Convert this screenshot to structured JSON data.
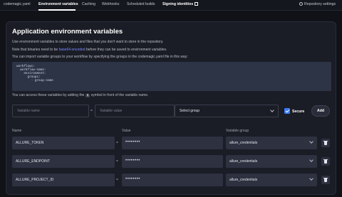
{
  "tabs": [
    {
      "label": "codemagic.yaml",
      "active": false
    },
    {
      "label": "Environment variables",
      "active": true
    },
    {
      "label": "Caching",
      "active": false
    },
    {
      "label": "Webhooks",
      "active": false
    },
    {
      "label": "Scheduled builds",
      "active": false
    },
    {
      "label": "Signing identities",
      "active": false
    }
  ],
  "repo_settings_label": "Repository settings",
  "section": {
    "title": "Application environment variables",
    "intro": "Use environment variables to store values and files that you don't want to store in the repository.",
    "binaries_pre": "Note that binaries need to be ",
    "binaries_link": "base64 encoded",
    "binaries_post": " before they can be saved to environment variables.",
    "import_note": "You can import variable groups to your workflow by specifying the groups in the codemagic.yaml file in this way:",
    "code": "workflows:\n  workflow-name:\n    environment:\n      groups:\n        - group-name",
    "access_pre": "You can access these variables by adding the",
    "access_symbol": "$",
    "access_post": "symbol in front of the variable name."
  },
  "form": {
    "name_placeholder": "Variable name",
    "equals": "=",
    "value_placeholder": "Variable value",
    "group_select": "Select group",
    "secure_label": "Secure",
    "secure_checked": true,
    "add_label": "Add"
  },
  "columns": {
    "name": "Name",
    "value": "Value",
    "group": "Variable group"
  },
  "variables": [
    {
      "name": "ALLURE_TOKEN",
      "equals": "=",
      "value": "••••••••",
      "group": "allure_credentials"
    },
    {
      "name": "ALLURE_ENDPOINT",
      "equals": "=",
      "value": "••••••••",
      "group": "allure_credentials"
    },
    {
      "name": "ALLURE_PROJECT_ID",
      "equals": "=",
      "value": "••••••••",
      "group": "allure_credentials"
    }
  ],
  "colors": {
    "accent": "#3d7bf5",
    "link": "#7a8cff",
    "background": "#101218",
    "card": "#1b1d26"
  }
}
